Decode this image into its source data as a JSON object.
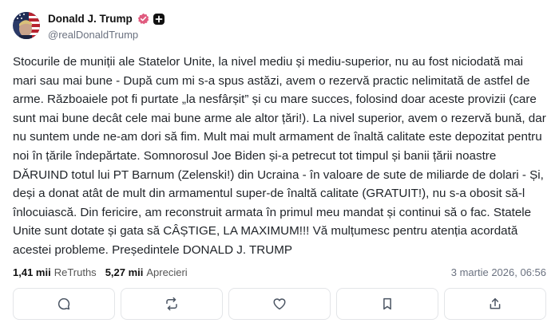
{
  "author": {
    "display_name": "Donald J. Trump",
    "handle": "@realDonaldTrump"
  },
  "post": {
    "text": "Stocurile de muniții ale Statelor Unite, la nivel mediu și mediu-superior, nu au fost niciodată mai mari sau mai bune - După cum mi s-a spus astăzi, avem o rezervă practic nelimitată de astfel de arme. Războaiele pot fi purtate „la nesfârșit” și cu mare succes, folosind doar aceste provizii (care sunt mai bune decât cele mai bune arme ale altor țări!). La nivel superior, avem o rezervă bună, dar nu suntem unde ne-am dori să fim. Mult mai mult armament de înaltă calitate este depozitat pentru noi în țările îndepărtate. Somnorosul Joe Biden și-a petrecut tot timpul și banii țării noastre DĂRUIND totul lui PT Barnum (Zelenski!) din Ucraina - în valoare de sute de miliarde de dolari - Și, deși a donat atât de mult din armamentul super-de înaltă calitate (GRATUIT!), nu s-a obosit să-l înlocuiască. Din fericire, am reconstruit armata în primul meu mandat și continui să o fac. Statele Unite sunt dotate și gata să CÂȘTIGE, LA MAXIMUM!!! Vă mulțumesc pentru atenția acordată acestei probleme. Președintele DONALD J. TRUMP"
  },
  "stats": {
    "retruths_count": "1,41 mii",
    "retruths_label": "ReTruths",
    "likes_count": "5,27 mii",
    "likes_label": "Aprecieri",
    "timestamp": "3 martie 2026, 06:56"
  },
  "icons": {
    "verified": "verified-badge-icon",
    "plus": "plus-badge-icon",
    "reply": "reply-icon",
    "retruth": "retruth-icon",
    "like": "heart-icon",
    "bookmark": "bookmark-icon",
    "share": "share-icon"
  },
  "colors": {
    "verified": "#e05b7f",
    "text": "#1f2328",
    "muted": "#6b7280",
    "border": "#e3e5e8"
  }
}
